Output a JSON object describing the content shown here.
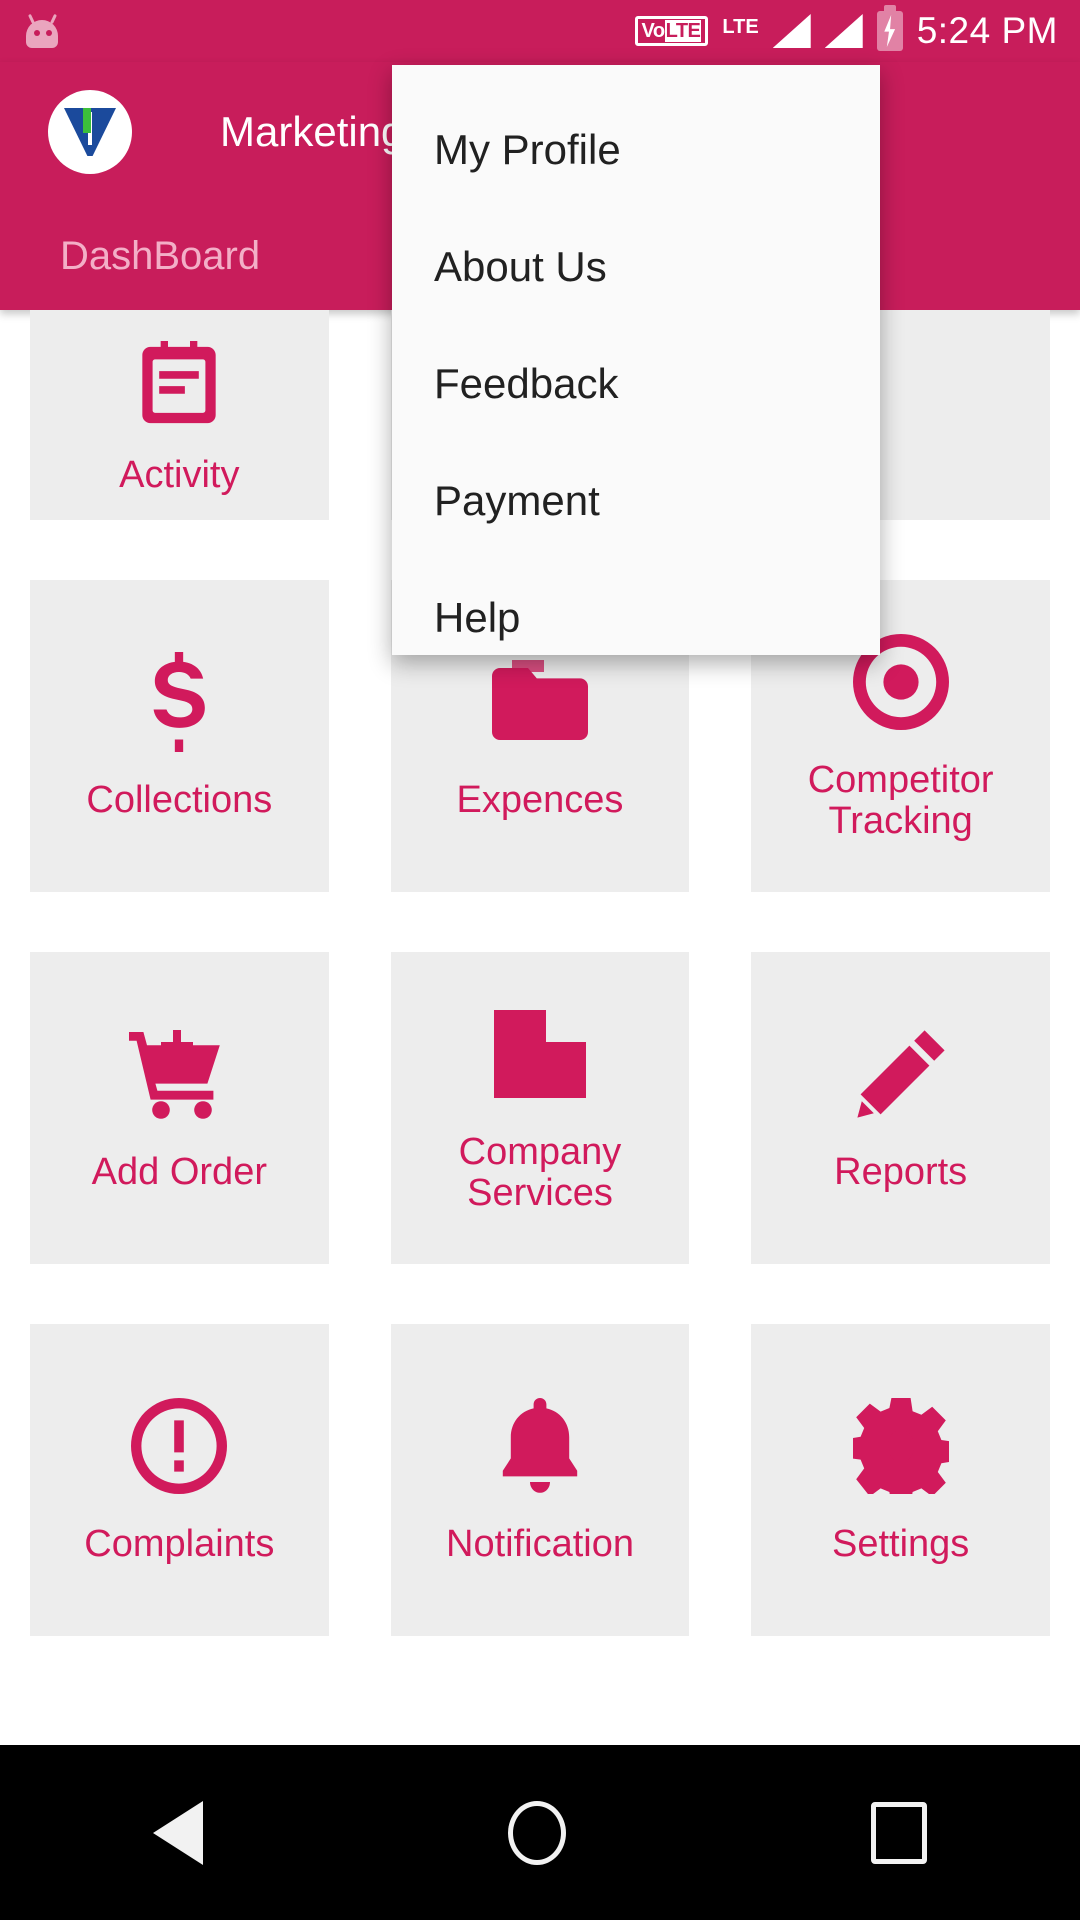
{
  "statusbar": {
    "volte_label": "VoLTE",
    "volte_prefix": "Vo",
    "volte_hi": "LTE",
    "network_label": "LTE",
    "time": "5:24 PM",
    "icons": [
      "android-head-icon",
      "volte-icon",
      "lte-icon",
      "signal-bars-icon",
      "signal-bars-icon",
      "battery-charging-icon"
    ]
  },
  "appbar": {
    "logo_name": "app-logo",
    "title": "Marketing",
    "brand_color": "#c81d5b"
  },
  "tabs": [
    {
      "label": "DashBoard",
      "active": true
    }
  ],
  "overflow_menu": {
    "visible": true,
    "items": [
      {
        "label": "My Profile"
      },
      {
        "label": "About Us"
      },
      {
        "label": "Feedback"
      },
      {
        "label": "Payment"
      },
      {
        "label": "Help"
      }
    ]
  },
  "grid": {
    "accent_color": "#d11a5c",
    "tile_bg": "#ededed",
    "tiles": [
      {
        "label": "Activity",
        "icon": "clipboard-icon"
      },
      {
        "label": "",
        "icon": "hidden-icon"
      },
      {
        "label": "",
        "icon": "hidden-icon"
      },
      {
        "label": "Collections",
        "icon": "dollar-icon"
      },
      {
        "label": "Expences",
        "icon": "folder-icon"
      },
      {
        "label": "Competitor Tracking",
        "icon": "target-icon"
      },
      {
        "label": "Add Order",
        "icon": "cart-plus-icon"
      },
      {
        "label": "Company Services",
        "icon": "building-icon"
      },
      {
        "label": "Reports",
        "icon": "pencil-icon"
      },
      {
        "label": "Complaints",
        "icon": "alert-circle-icon"
      },
      {
        "label": "Notification",
        "icon": "bell-icon"
      },
      {
        "label": "Settings",
        "icon": "gear-icon"
      }
    ]
  },
  "navbar": {
    "back_label": "Back",
    "home_label": "Home",
    "recents_label": "Recents"
  }
}
